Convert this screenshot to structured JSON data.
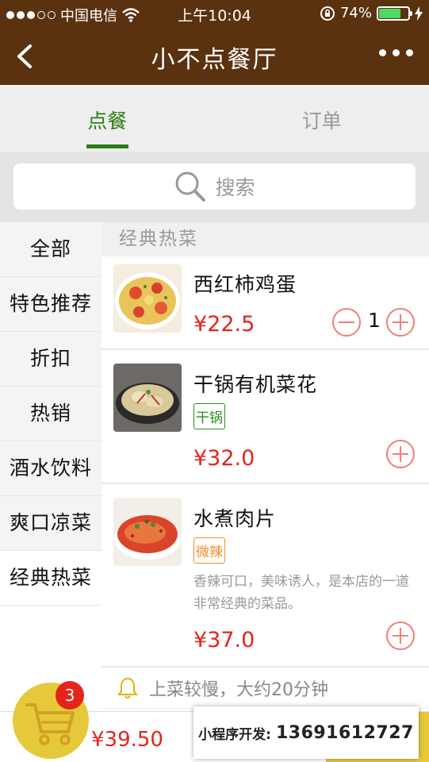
{
  "status": {
    "carrier": "中国电信",
    "time": "上午10:04",
    "battery": "74%"
  },
  "header": {
    "title": "小不点餐厅"
  },
  "tabs": [
    {
      "label": "点餐",
      "active": true
    },
    {
      "label": "订单",
      "active": false
    }
  ],
  "search": {
    "placeholder": "搜索"
  },
  "categories": [
    {
      "label": "全部"
    },
    {
      "label": "特色推荐"
    },
    {
      "label": "折扣"
    },
    {
      "label": "热销"
    },
    {
      "label": "酒水饮料"
    },
    {
      "label": "爽口凉菜"
    },
    {
      "label": "经典热菜",
      "active": true
    }
  ],
  "section": {
    "title": "经典热菜"
  },
  "dishes": [
    {
      "name": "西红柿鸡蛋",
      "price": "¥22.5",
      "qty": "1"
    },
    {
      "name": "干锅有机菜花",
      "price": "¥32.0",
      "tag": "干锅",
      "tag_color": "#2a8f1a"
    },
    {
      "name": "水煮肉片",
      "price": "¥37.0",
      "tag": "微辣",
      "tag_color": "#f08c2e",
      "desc": "香辣可口，美味诱人，是本店的一道非常经典的菜品。"
    }
  ],
  "notice": {
    "text": "上菜较慢，大约20分钟"
  },
  "cart": {
    "count": "3",
    "total": "¥39.50"
  },
  "promo": {
    "label": "小程序开发:",
    "phone": "13691612727"
  },
  "colors": {
    "header": "#5a3210",
    "accent_green": "#2a7d12",
    "price_red": "#e5241b",
    "cart_yellow": "#e6c93a",
    "plus_minus": "#f07f75"
  }
}
